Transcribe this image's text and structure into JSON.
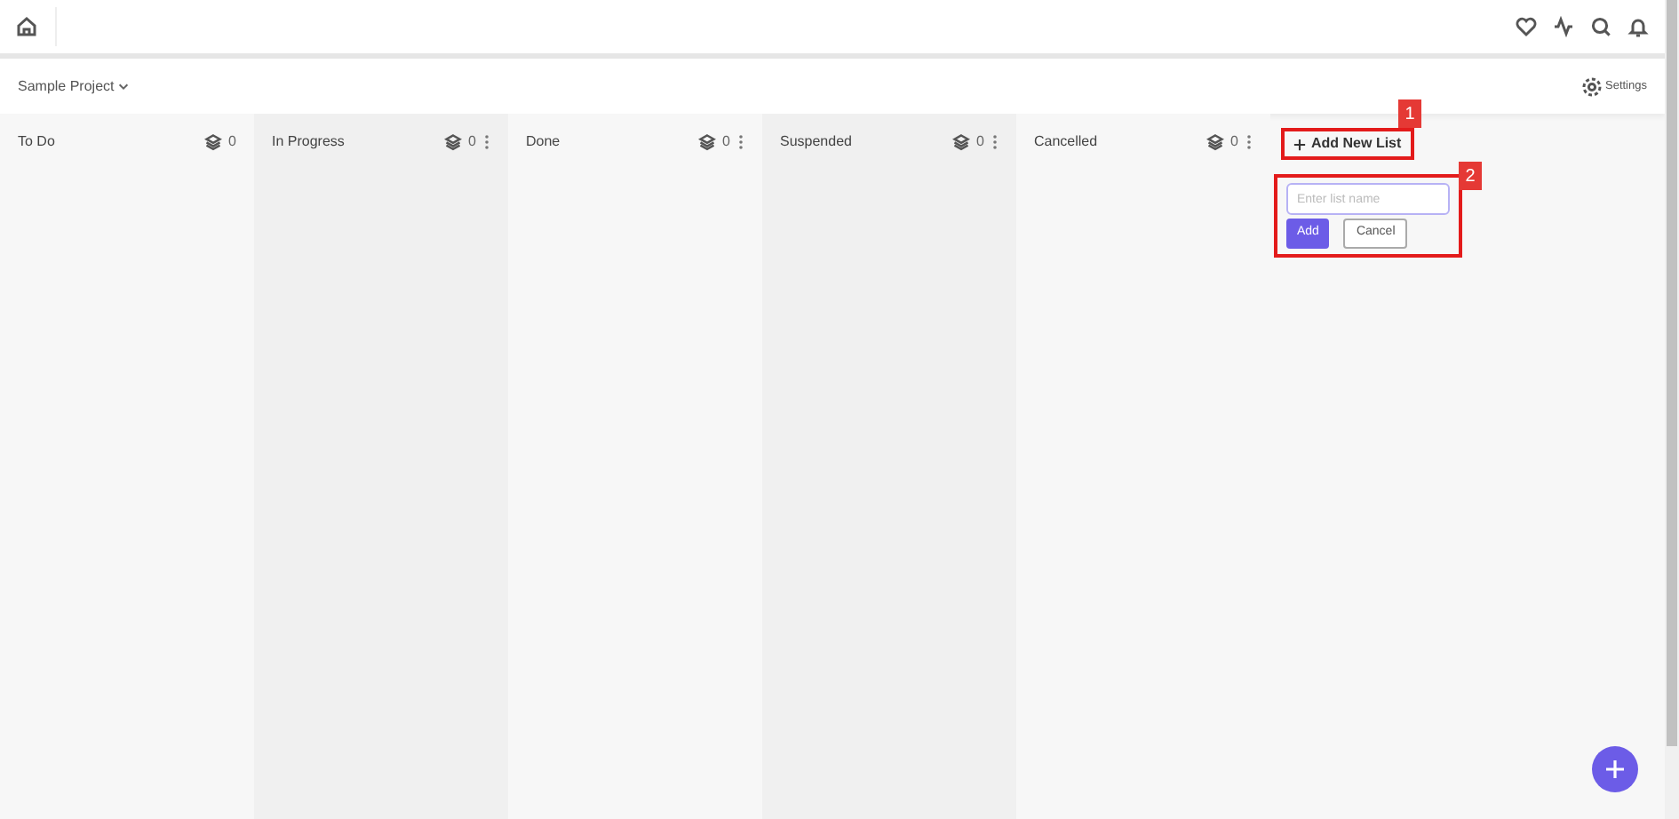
{
  "project": {
    "name": "Sample Project"
  },
  "settings": {
    "label": "Settings"
  },
  "columns": [
    {
      "title": "To Do",
      "count": "0",
      "menu": false
    },
    {
      "title": "In Progress",
      "count": "0",
      "menu": true
    },
    {
      "title": "Done",
      "count": "0",
      "menu": true
    },
    {
      "title": "Suspended",
      "count": "0",
      "menu": true
    },
    {
      "title": "Cancelled",
      "count": "0",
      "menu": true
    }
  ],
  "add_list": {
    "label": "Add New List",
    "placeholder": "Enter list name",
    "add_button": "Add",
    "cancel_button": "Cancel"
  },
  "annotations": [
    "1",
    "2"
  ]
}
